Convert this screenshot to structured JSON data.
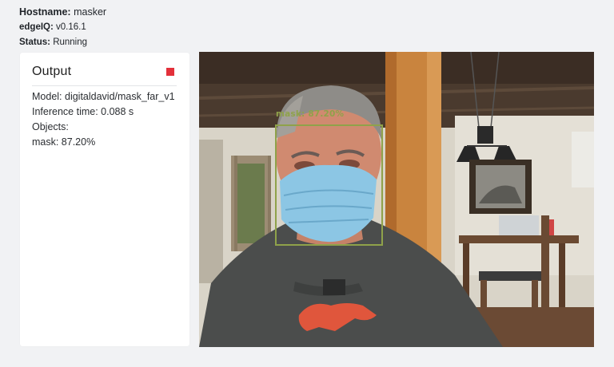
{
  "header": {
    "hostname_label": "Hostname:",
    "hostname_value": "masker",
    "version_label": "edgeIQ:",
    "version_value": "v0.16.1",
    "status_label": "Status:",
    "status_value": "Running"
  },
  "output": {
    "title": "Output",
    "stop_icon": "stop-square-icon",
    "model_line": "Model: digitaldavid/mask_far_v1",
    "inference_line": "Inference time: 0.088 s",
    "objects_line": "Objects:",
    "object_items": [
      "mask: 87.20%"
    ]
  },
  "video": {
    "detection_label": "mask: 87.20%",
    "box_color": "#8fa24a",
    "accent_stop_color": "#e3303a"
  }
}
